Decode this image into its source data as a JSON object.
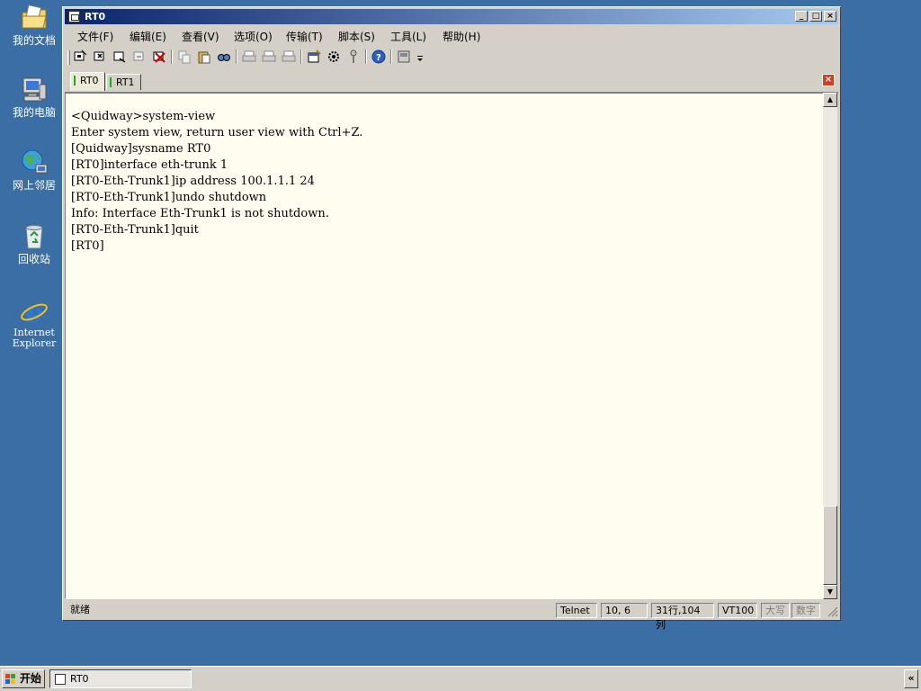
{
  "desktop": {
    "icons": [
      {
        "label": "我的文档",
        "icon": "my-documents-icon"
      },
      {
        "label": "我的电脑",
        "icon": "my-computer-icon"
      },
      {
        "label": "网上邻居",
        "icon": "network-places-icon"
      },
      {
        "label": "回收站",
        "icon": "recycle-bin-icon"
      },
      {
        "label": "Internet Explorer",
        "icon": "internet-explorer-icon"
      }
    ]
  },
  "window": {
    "title": "RT0",
    "controls": {
      "minimize": "_",
      "maximize": "□",
      "close": "×"
    },
    "menu": [
      {
        "label": "文件(F)"
      },
      {
        "label": "编辑(E)"
      },
      {
        "label": "查看(V)"
      },
      {
        "label": "选项(O)"
      },
      {
        "label": "传输(T)"
      },
      {
        "label": "脚本(S)"
      },
      {
        "label": "工具(L)"
      },
      {
        "label": "帮助(H)"
      }
    ],
    "tabs": [
      {
        "label": "RT0",
        "active": true
      },
      {
        "label": "RT1",
        "active": false
      }
    ],
    "terminal": {
      "lines": [
        "<Quidway>system-view",
        "Enter system view, return user view with Ctrl+Z.",
        "[Quidway]sysname RT0",
        "[RT0]interface eth-trunk 1",
        "[RT0-Eth-Trunk1]ip address 100.1.1.1 24",
        "[RT0-Eth-Trunk1]undo shutdown",
        "Info: Interface Eth-Trunk1 is not shutdown.",
        "[RT0-Eth-Trunk1]quit",
        "[RT0]"
      ]
    },
    "status": {
      "ready": "就绪",
      "protocol": "Telnet",
      "cursor_pos": "10,   6",
      "size": "31行,104列",
      "emulation": "VT100",
      "caps": "大写",
      "num": "数字"
    }
  },
  "taskbar": {
    "start_label": "开始",
    "task_label": "RT0",
    "tray_toggle": "«"
  },
  "colors": {
    "desktop": "#3a6ea5",
    "titlebar_start": "#0a246a",
    "titlebar_end": "#a6caf0",
    "terminal_bg": "#fffdf0",
    "tab_marker": "#18b018",
    "close_tab": "#d04020"
  }
}
